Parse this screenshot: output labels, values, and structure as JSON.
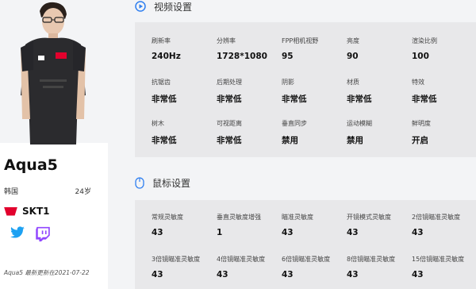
{
  "player": {
    "name": "Aqua5",
    "country": "韩国",
    "age": "24岁",
    "team": "SKT1",
    "updated": "Aqua5 最新更新在2021-07-22"
  },
  "video": {
    "title": "视频设置",
    "settings": [
      {
        "label": "刷新率",
        "value": "240Hz"
      },
      {
        "label": "分辨率",
        "value": "1728*1080"
      },
      {
        "label": "FPP相机视野",
        "value": "95"
      },
      {
        "label": "亮度",
        "value": "90"
      },
      {
        "label": "渲染比例",
        "value": "100"
      },
      {
        "label": "抗锯齿",
        "value": "非常低"
      },
      {
        "label": "后期处理",
        "value": "非常低"
      },
      {
        "label": "阴影",
        "value": "非常低"
      },
      {
        "label": "材质",
        "value": "非常低"
      },
      {
        "label": "特效",
        "value": "非常低"
      },
      {
        "label": "树木",
        "value": "非常低"
      },
      {
        "label": "可视距离",
        "value": "非常低"
      },
      {
        "label": "垂直同步",
        "value": "禁用"
      },
      {
        "label": "运动模糊",
        "value": "禁用"
      },
      {
        "label": "鲜明度",
        "value": "开启"
      }
    ]
  },
  "mouse": {
    "title": "鼠标设置",
    "settings": [
      {
        "label": "常规灵敏度",
        "value": "43"
      },
      {
        "label": "垂直灵敏度增强",
        "value": "1"
      },
      {
        "label": "瞄准灵敏度",
        "value": "43"
      },
      {
        "label": "开镜模式灵敏度",
        "value": "43"
      },
      {
        "label": "2倍镜瞄准灵敏度",
        "value": "43"
      },
      {
        "label": "3倍镜瞄准灵敏度",
        "value": "43"
      },
      {
        "label": "4倍镜瞄准灵敏度",
        "value": "43"
      },
      {
        "label": "6倍镜瞄准灵敏度",
        "value": "43"
      },
      {
        "label": "8倍镜瞄准灵敏度",
        "value": "43"
      },
      {
        "label": "15倍镜瞄准灵敏度",
        "value": "43"
      }
    ]
  },
  "colors": {
    "accent": "#2f7ff0",
    "twitter": "#1da1f2",
    "twitch": "#9146ff",
    "team": "#e2012d"
  },
  "icons": [
    "play-circle-icon",
    "mouse-icon",
    "twitter-icon",
    "twitch-icon",
    "team-logo-icon"
  ]
}
